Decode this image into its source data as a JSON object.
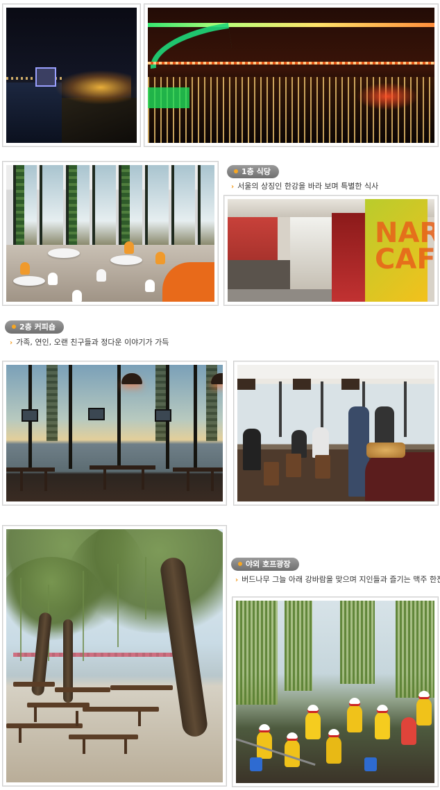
{
  "sections": {
    "floor1": {
      "badge": "1층 식당",
      "caption": "서울의 상징인 한강을 바라 보며 특별한 식사"
    },
    "floor2": {
      "badge": "2층 커피숍",
      "caption": "가족, 연인, 오랜 친구들과 정다운 이야기가 가득"
    },
    "outdoor": {
      "badge": "야외 호프광장",
      "caption": "버드나무 그늘 아래 강바람을 맞으며 지인들과 즐기는 맥주 한잔"
    }
  },
  "photos": {
    "cafe_sign": "NAR CAFE"
  },
  "colors": {
    "badge_bg": "#7f7f7f",
    "badge_dot": "#f6a623",
    "caption_arrow": "#f29a1d",
    "frame_border": "#cfcfcf"
  },
  "icons": {
    "badge_bullet": "orange-dot-icon",
    "caption_bullet": "chevron-right-icon"
  }
}
